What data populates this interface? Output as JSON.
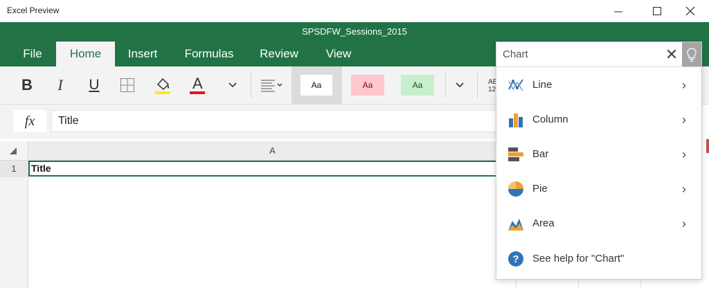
{
  "window": {
    "app_title": "Excel Preview",
    "doc_title": "SPSDFW_Sessions_2015"
  },
  "tabs": [
    {
      "label": "File"
    },
    {
      "label": "Home"
    },
    {
      "label": "Insert"
    },
    {
      "label": "Formulas"
    },
    {
      "label": "Review"
    },
    {
      "label": "View"
    }
  ],
  "ribbon": {
    "bold": "B",
    "italic": "I",
    "underline": "U",
    "font_color_letter": "A",
    "style_normal": "Aa",
    "style_bad": "Aa",
    "style_good": "Aa",
    "number_format_partial": "AB\n12"
  },
  "formula_bar": {
    "fx_label": "fx",
    "value": "Title"
  },
  "sheet": {
    "column_header": "A",
    "row_number": "1",
    "cell_value": "Title"
  },
  "tell_me": {
    "placeholder": "Chart",
    "value": "Chart",
    "clear_glyph": "✕",
    "items": [
      {
        "label": "Line"
      },
      {
        "label": "Column"
      },
      {
        "label": "Bar"
      },
      {
        "label": "Pie"
      },
      {
        "label": "Area"
      },
      {
        "label": "See help for \"Chart\""
      }
    ]
  },
  "colors": {
    "accent": "#217346",
    "fill_yellow": "#ffeb00",
    "font_red": "#e81123",
    "bad_fill": "#ffc7ce",
    "good_fill": "#c6efce"
  }
}
